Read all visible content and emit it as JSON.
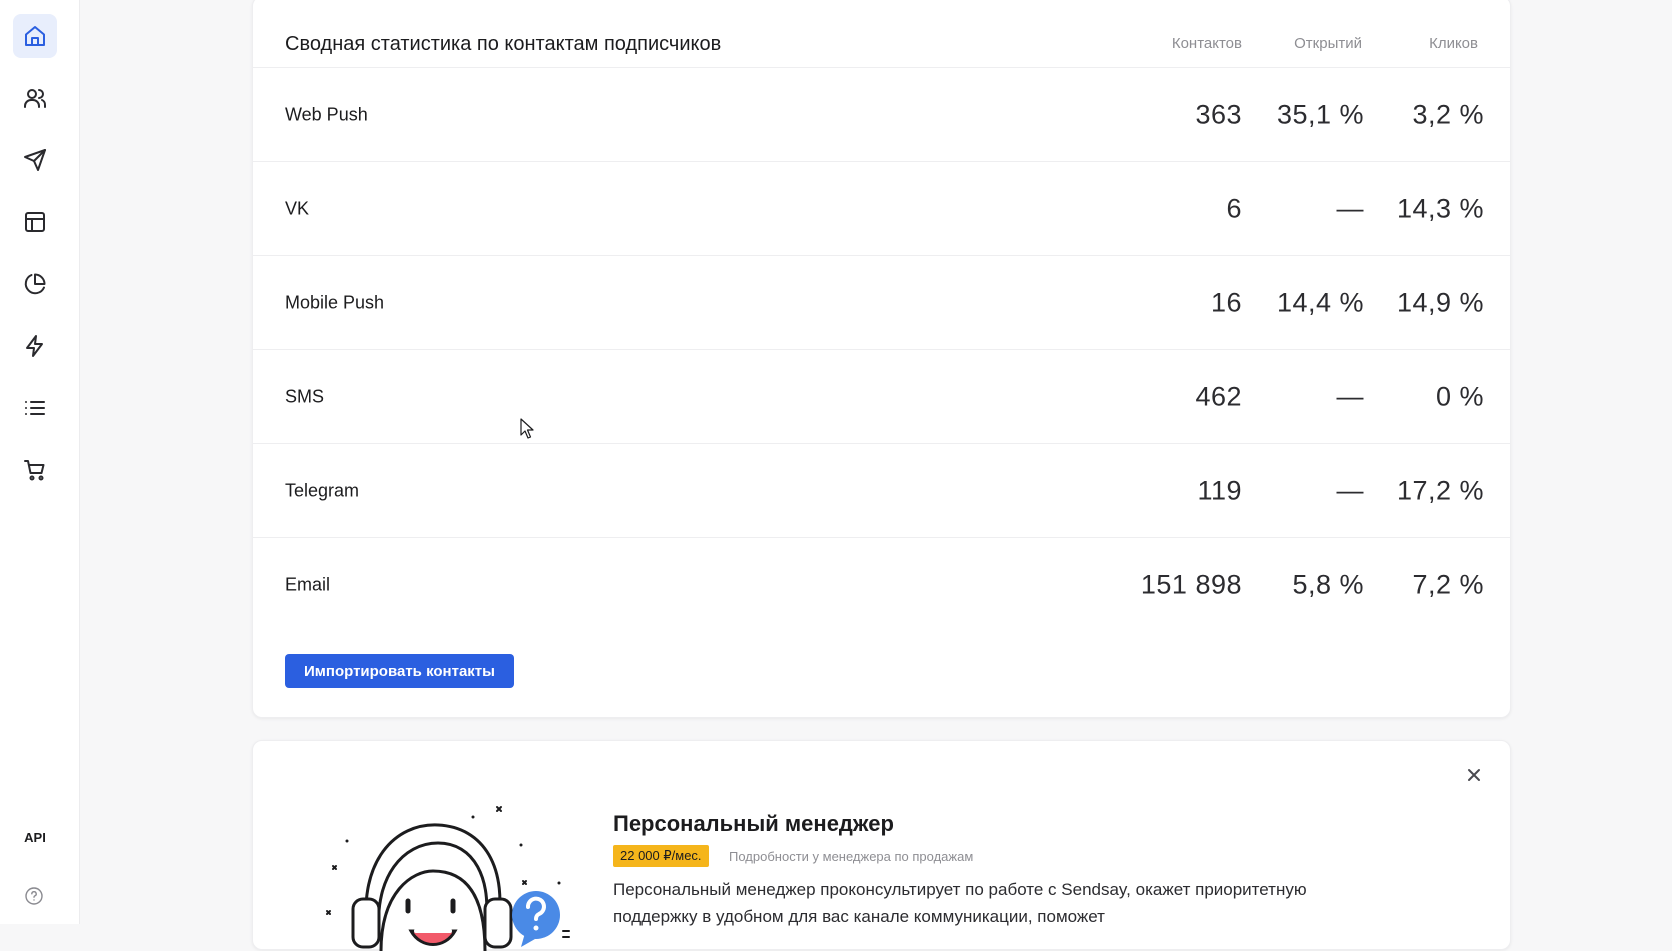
{
  "sidebar": {
    "items": [
      {
        "icon": "home-icon",
        "active": true
      },
      {
        "icon": "users-icon",
        "active": false
      },
      {
        "icon": "send-icon",
        "active": false
      },
      {
        "icon": "layout-icon",
        "active": false
      },
      {
        "icon": "pie-chart-icon",
        "active": false
      },
      {
        "icon": "lightning-icon",
        "active": false
      },
      {
        "icon": "list-icon",
        "active": false
      },
      {
        "icon": "cart-icon",
        "active": false
      }
    ],
    "api_label": "API",
    "help_icon": "help-circle-icon"
  },
  "stats": {
    "title": "Сводная статистика по контактам подписчиков",
    "columns": [
      "Контактов",
      "Открытий",
      "Кликов"
    ],
    "rows": [
      {
        "label": "Web Push",
        "contacts": "363",
        "opens": "35,1 %",
        "clicks": "3,2 %"
      },
      {
        "label": "VK",
        "contacts": "6",
        "opens": "—",
        "clicks": "14,3 %"
      },
      {
        "label": "Mobile Push",
        "contacts": "16",
        "opens": "14,4 %",
        "clicks": "14,9 %"
      },
      {
        "label": "SMS",
        "contacts": "462",
        "opens": "—",
        "clicks": "0 %"
      },
      {
        "label": "Telegram",
        "contacts": "119",
        "opens": "—",
        "clicks": "17,2 %"
      },
      {
        "label": "Email",
        "contacts": "151 898",
        "opens": "5,8 %",
        "clicks": "7,2 %"
      }
    ],
    "import_button": "Импортировать контакты"
  },
  "promo": {
    "title": "Персональный менеджер",
    "price": "22 000 ₽/мес.",
    "price_note": "Подробности у менеджера по продажам",
    "description": "Персональный менеджер проконсультирует по работе с Sendsay, окажет приоритетную поддержку в удобном для вас канале коммуникации, поможет",
    "close_icon": "close-icon"
  },
  "colors": {
    "accent": "#2b5fe0",
    "active_bg": "#e8eefc",
    "badge": "#f5b51b"
  }
}
